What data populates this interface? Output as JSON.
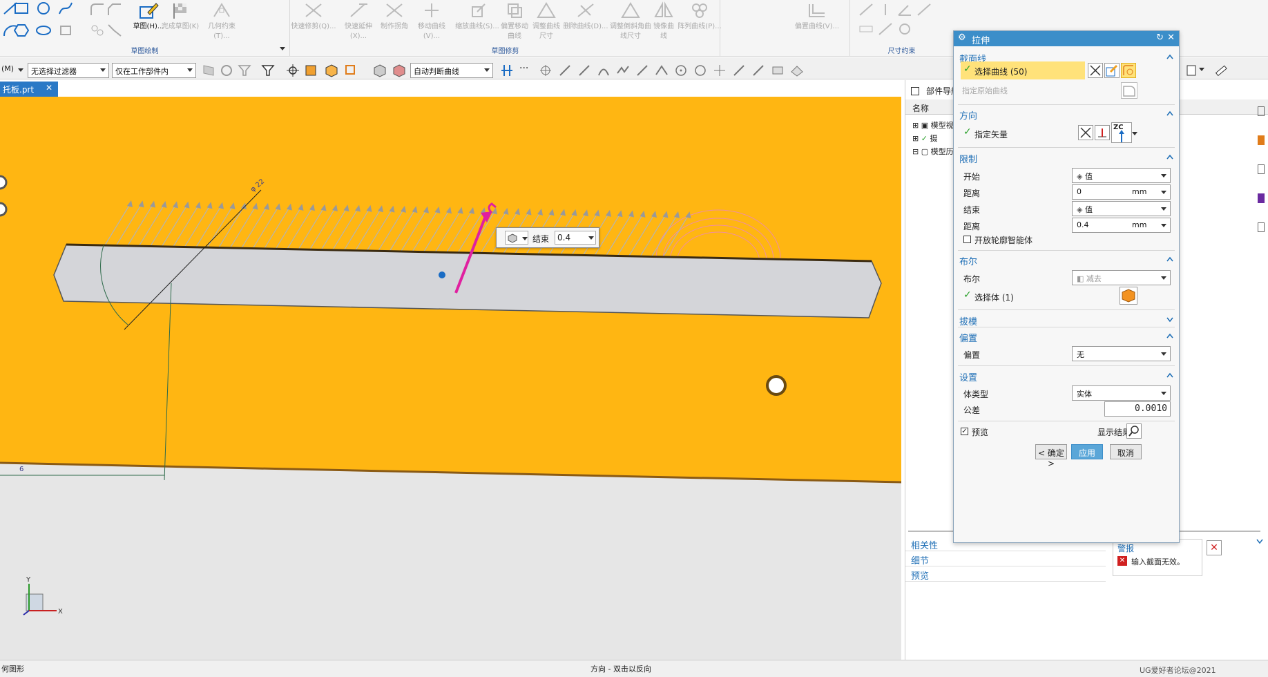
{
  "ribbon": {
    "groups": [
      {
        "title": "草图绘制"
      },
      {
        "title": "草图修剪"
      },
      {
        "title": "尺寸约束"
      }
    ],
    "commands": [
      {
        "label": "草图(H)...",
        "enabled": true
      },
      {
        "label": "完成草图(K)",
        "enabled": false
      },
      {
        "label": "几何约束(T)...",
        "enabled": false
      },
      {
        "label": "快速修剪(Q)...",
        "enabled": false
      },
      {
        "label": "快速延伸(X)...",
        "enabled": false
      },
      {
        "label": "制作拐角",
        "enabled": false
      },
      {
        "label": "移动曲线(V)...",
        "enabled": false
      },
      {
        "label": "缩放曲线(S)...",
        "enabled": false
      },
      {
        "label": "偏置移动曲线",
        "enabled": false
      },
      {
        "label": "调整曲线尺寸",
        "enabled": false
      },
      {
        "label": "删除曲线(D)...",
        "enabled": false
      },
      {
        "label": "调整倒斜角曲线尺寸",
        "enabled": false
      },
      {
        "label": "镜像曲线",
        "enabled": false
      },
      {
        "label": "阵列曲线(P)...",
        "enabled": false
      },
      {
        "label": "偏置曲线(V)..."
      }
    ]
  },
  "toolbar": {
    "menu_prefix": "(M)",
    "filter": "无选择过滤器",
    "scope": "仅在工作部件内",
    "curve_rule": "自动判断曲线"
  },
  "tab": {
    "label": "托板.prt"
  },
  "viewport": {
    "float_end_label": "结束",
    "float_end_value": "0.4",
    "dim_label_1": "φ 22",
    "dim_label_2": "6"
  },
  "navigator": {
    "title": "部件导航",
    "col_name": "名称",
    "nodes": [
      "模型视",
      "摄",
      "模型历"
    ]
  },
  "dialog": {
    "title": "拉伸",
    "sections": {
      "section": {
        "title": "截面线",
        "select_curve": "选择曲线 (50)",
        "specify_origin": "指定原始曲线"
      },
      "direction": {
        "title": "方向",
        "specify_vector": "指定矢量",
        "vector_label": "ZC"
      },
      "limits": {
        "title": "限制",
        "start_label": "开始",
        "start_value": "值",
        "start_dist_label": "距离",
        "start_dist_value": "0",
        "start_unit": "mm",
        "end_label": "结束",
        "end_value": "值",
        "end_dist_label": "距离",
        "end_dist_value": "0.4",
        "end_unit": "mm",
        "open_profile": "开放轮廓智能体"
      },
      "boolean": {
        "title": "布尔",
        "label": "布尔",
        "value": "减去",
        "select_body": "选择体 (1)"
      },
      "draft": {
        "title": "拔模"
      },
      "offset": {
        "title": "偏置",
        "label": "偏置",
        "value": "无"
      },
      "settings": {
        "title": "设置",
        "body_type_label": "体类型",
        "body_type_value": "实体",
        "tolerance_label": "公差",
        "tolerance_value": "0.0010"
      }
    },
    "preview_label": "预览",
    "show_result": "显示结果",
    "ok_label": "< 确定 >",
    "apply_label": "应用",
    "cancel_label": "取消"
  },
  "bottom_panels": {
    "related": "相关性",
    "details": "细节",
    "preview": "预览"
  },
  "alert": {
    "title": "警报",
    "message": "输入截面无效。"
  },
  "status": {
    "left": "何图形",
    "center": "方向 - 双击以反向",
    "watermark": "UG爱好者论坛@2021"
  },
  "colors": {
    "accent": "#3c8ec9",
    "face": "#ffb612",
    "highlight": "#ffe27a"
  }
}
